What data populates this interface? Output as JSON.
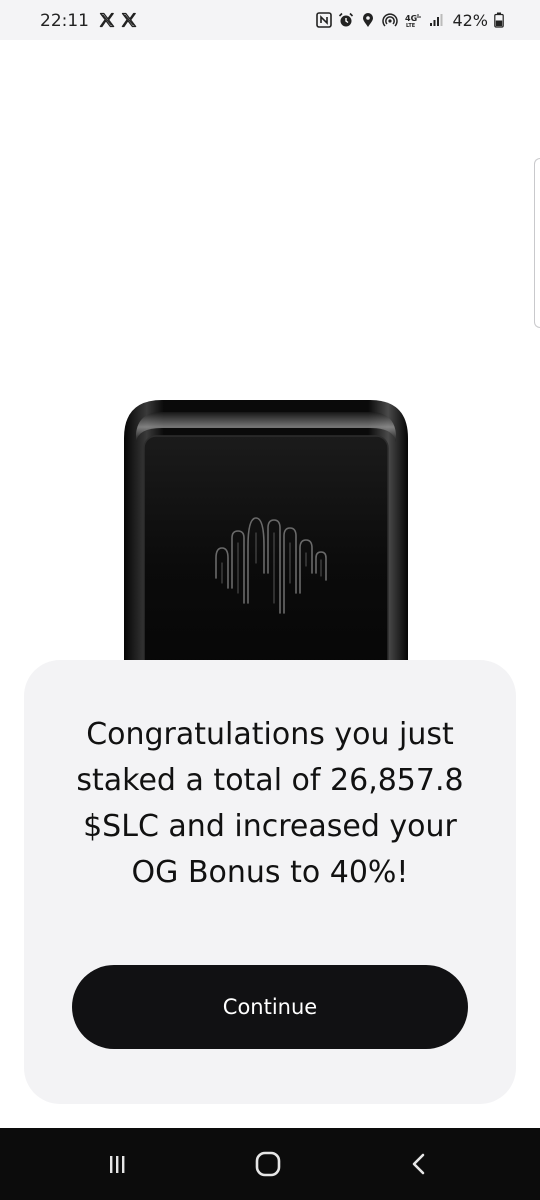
{
  "status_bar": {
    "time": "22:11",
    "notification_icons": [
      "x-icon",
      "x-icon"
    ],
    "system_icons": [
      "nfc-icon",
      "alarm-icon",
      "location-icon",
      "hotspot-icon",
      "network-4g-lte-icon",
      "signal-icon"
    ],
    "battery_percent": "42%"
  },
  "product": {
    "icon": "soundwave-logo-icon"
  },
  "card": {
    "message": "Congratulations you just staked a total of 26,857.8 $SLC and increased your OG Bonus to 40%!",
    "continue_label": "Continue"
  },
  "nav_bar": {
    "buttons": [
      "recent-apps",
      "home",
      "back"
    ]
  }
}
